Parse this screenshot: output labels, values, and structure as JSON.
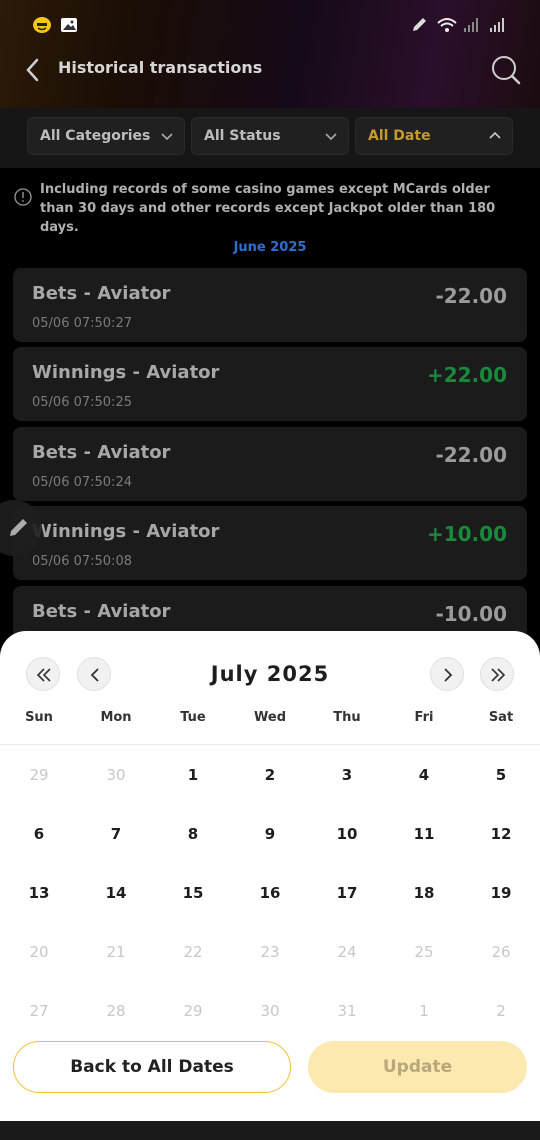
{
  "header": {
    "title": "Historical transactions"
  },
  "filters": {
    "category": "All Categories",
    "status": "All Status",
    "date": "All Date"
  },
  "notice": "Including records of some casino games except MCards older than 30 days and other records except Jackpot older than 180 days.",
  "month_label": "June 2025",
  "transactions": [
    {
      "name": "Bets - Aviator",
      "time": "05/06 07:50:27",
      "amount": "-22.00"
    },
    {
      "name": "Winnings - Aviator",
      "time": "05/06 07:50:25",
      "amount": "+22.00"
    },
    {
      "name": "Bets - Aviator",
      "time": "05/06 07:50:24",
      "amount": "-22.00"
    },
    {
      "name": "Winnings - Aviator",
      "time": "05/06 07:50:08",
      "amount": "+10.00"
    },
    {
      "name": "Bets - Aviator",
      "time": "",
      "amount": "-10.00"
    }
  ],
  "calendar": {
    "title": "July  2025",
    "weekdays": [
      "Sun",
      "Mon",
      "Tue",
      "Wed",
      "Thu",
      "Fri",
      "Sat"
    ],
    "weeks": [
      [
        "29",
        "30",
        "1",
        "2",
        "3",
        "4",
        "5"
      ],
      [
        "6",
        "7",
        "8",
        "9",
        "10",
        "11",
        "12"
      ],
      [
        "13",
        "14",
        "15",
        "16",
        "17",
        "18",
        "19"
      ],
      [
        "20",
        "21",
        "22",
        "23",
        "24",
        "25",
        "26"
      ],
      [
        "27",
        "28",
        "29",
        "30",
        "31",
        "1",
        "2"
      ]
    ],
    "back_label": "Back to All Dates",
    "update_label": "Update"
  },
  "colors": {
    "accent": "#f0c23a",
    "positive": "#198a3c",
    "month_label": "#2e6fd0"
  }
}
